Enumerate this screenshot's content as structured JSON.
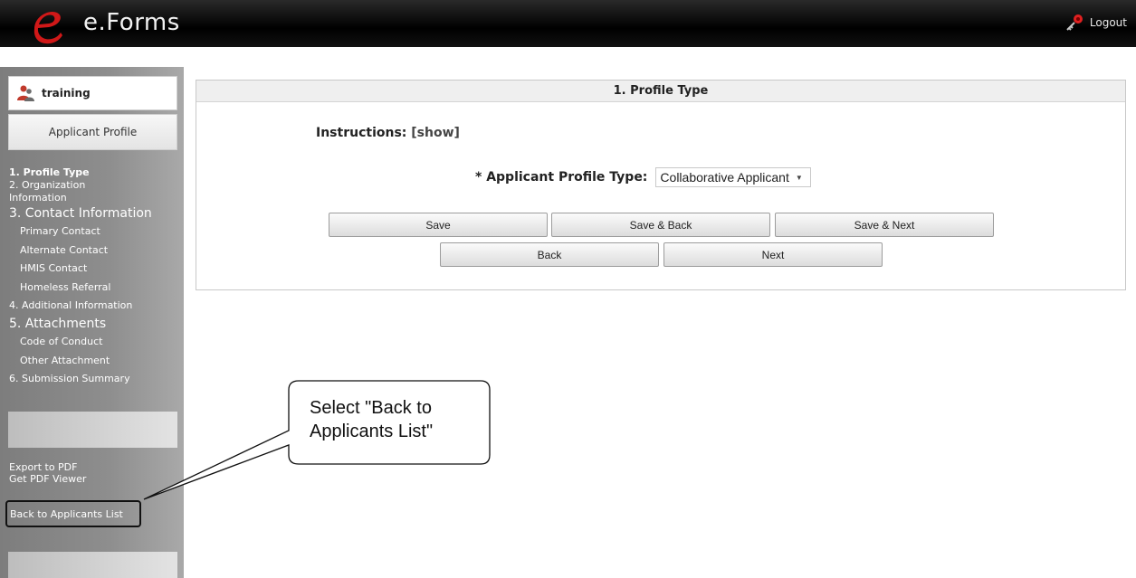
{
  "header": {
    "logo_text": "e.Forms",
    "logout_label": "Logout",
    "logo_color": "#d01818"
  },
  "sidebar": {
    "user_name": "training",
    "profile_tab": "Applicant Profile",
    "nav": [
      {
        "label": "1. Profile Type"
      },
      {
        "label": "2. Organization Information"
      },
      {
        "label": "3. Contact Information"
      },
      {
        "label": "Primary Contact"
      },
      {
        "label": "Alternate Contact"
      },
      {
        "label": "HMIS Contact"
      },
      {
        "label": "Homeless Referral"
      },
      {
        "label": "4. Additional Information"
      },
      {
        "label": "5. Attachments"
      },
      {
        "label": "Code of Conduct"
      },
      {
        "label": "Other Attachment"
      },
      {
        "label": "6. Submission Summary"
      }
    ],
    "tools": {
      "export_pdf": "Export to PDF",
      "pdf_viewer": "Get PDF Viewer",
      "back_to_list": "Back to Applicants List"
    }
  },
  "main": {
    "title": "1. Profile Type",
    "instructions_label": "Instructions:",
    "instructions_toggle": "[show]",
    "profile_type_label": "* Applicant Profile Type:",
    "profile_type_value": "Collaborative Applicant",
    "buttons": {
      "save": "Save",
      "save_back": "Save & Back",
      "save_next": "Save & Next",
      "back": "Back",
      "next": "Next"
    }
  },
  "callout": {
    "text": "Select \"Back to Applicants List\""
  }
}
